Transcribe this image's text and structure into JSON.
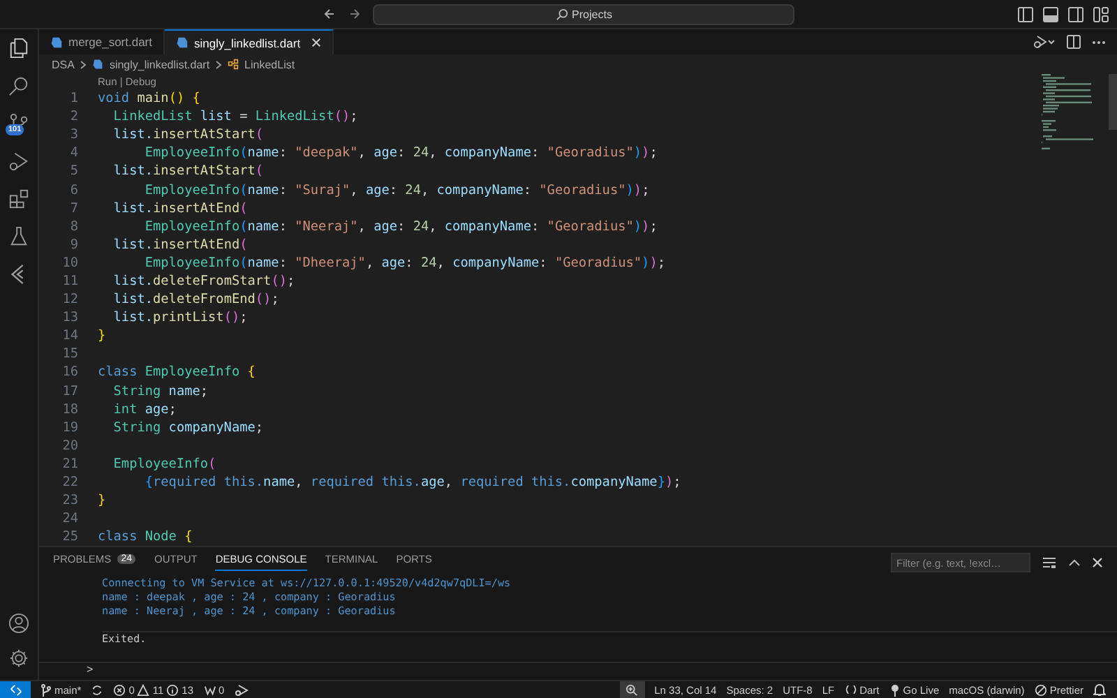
{
  "title_bar": {
    "search": "Projects"
  },
  "activity_bar": {
    "source_control_badge": "101"
  },
  "tabs": [
    {
      "label": "merge_sort.dart",
      "selected": false
    },
    {
      "label": "singly_linkedlist.dart",
      "selected": true
    }
  ],
  "breadcrumb": [
    "DSA",
    "singly_linkedlist.dart",
    "LinkedList"
  ],
  "codelens": "Run | Debug",
  "code_lines": [
    {
      "number": "1",
      "tokens": [
        {
          "text": "void ",
          "kind": "k"
        },
        {
          "text": "main",
          "kind": "f"
        },
        {
          "text": "() ",
          "kind": "b1"
        },
        {
          "text": "{",
          "kind": "b1"
        }
      ],
      "children": [
        {
          "number": "2",
          "tokens": [
            {
              "text": "LinkedList ",
              "kind": "t"
            },
            {
              "text": "list ",
              "kind": "v"
            },
            {
              "text": "= ",
              "kind": "p"
            },
            {
              "text": "LinkedList",
              "kind": "t"
            },
            {
              "text": "()",
              "kind": "b2"
            },
            {
              "text": ";",
              "kind": "p"
            }
          ]
        },
        {
          "number": "3",
          "tokens": [
            {
              "text": "list.",
              "kind": "v"
            },
            {
              "text": "insertAtStart",
              "kind": "f"
            },
            {
              "text": "(",
              "kind": "b2"
            }
          ],
          "children": [
            {
              "number": "4",
              "tokens": [
                {
                  "text": "EmployeeInfo",
                  "kind": "t"
                },
                {
                  "text": "(",
                  "kind": "b3"
                },
                {
                  "text": "name",
                  "kind": "v"
                },
                {
                  "text": ": ",
                  "kind": "p"
                },
                {
                  "text": "\"deepak\"",
                  "kind": "s"
                },
                {
                  "text": ", ",
                  "kind": "p"
                },
                {
                  "text": "age",
                  "kind": "v"
                },
                {
                  "text": ": ",
                  "kind": "p"
                },
                {
                  "text": "24",
                  "kind": "n"
                },
                {
                  "text": ", ",
                  "kind": "p"
                },
                {
                  "text": "companyName",
                  "kind": "v"
                },
                {
                  "text": ": ",
                  "kind": "p"
                },
                {
                  "text": "\"Georadius\"",
                  "kind": "s"
                },
                {
                  "text": ")",
                  "kind": "b3"
                },
                {
                  "text": ")",
                  "kind": "b2"
                },
                {
                  "text": ";",
                  "kind": "p"
                }
              ]
            }
          ]
        },
        {
          "number": "5",
          "tokens": [
            {
              "text": "list.",
              "kind": "v"
            },
            {
              "text": "insertAtStart",
              "kind": "f"
            },
            {
              "text": "(",
              "kind": "b2"
            }
          ],
          "children": [
            {
              "number": "6",
              "tokens": [
                {
                  "text": "EmployeeInfo",
                  "kind": "t"
                },
                {
                  "text": "(",
                  "kind": "b3"
                },
                {
                  "text": "name",
                  "kind": "v"
                },
                {
                  "text": ": ",
                  "kind": "p"
                },
                {
                  "text": "\"Suraj\"",
                  "kind": "s"
                },
                {
                  "text": ", ",
                  "kind": "p"
                },
                {
                  "text": "age",
                  "kind": "v"
                },
                {
                  "text": ": ",
                  "kind": "p"
                },
                {
                  "text": "24",
                  "kind": "n"
                },
                {
                  "text": ", ",
                  "kind": "p"
                },
                {
                  "text": "companyName",
                  "kind": "v"
                },
                {
                  "text": ": ",
                  "kind": "p"
                },
                {
                  "text": "\"Georadius\"",
                  "kind": "s"
                },
                {
                  "text": ")",
                  "kind": "b3"
                },
                {
                  "text": ")",
                  "kind": "b2"
                },
                {
                  "text": ";",
                  "kind": "p"
                }
              ]
            }
          ]
        },
        {
          "number": "7",
          "tokens": [
            {
              "text": "list.",
              "kind": "v"
            },
            {
              "text": "insertAtEnd",
              "kind": "f"
            },
            {
              "text": "(",
              "kind": "b2"
            }
          ],
          "children": [
            {
              "number": "8",
              "tokens": [
                {
                  "text": "EmployeeInfo",
                  "kind": "t"
                },
                {
                  "text": "(",
                  "kind": "b3"
                },
                {
                  "text": "name",
                  "kind": "v"
                },
                {
                  "text": ": ",
                  "kind": "p"
                },
                {
                  "text": "\"Neeraj\"",
                  "kind": "s"
                },
                {
                  "text": ", ",
                  "kind": "p"
                },
                {
                  "text": "age",
                  "kind": "v"
                },
                {
                  "text": ": ",
                  "kind": "p"
                },
                {
                  "text": "24",
                  "kind": "n"
                },
                {
                  "text": ", ",
                  "kind": "p"
                },
                {
                  "text": "companyName",
                  "kind": "v"
                },
                {
                  "text": ": ",
                  "kind": "p"
                },
                {
                  "text": "\"Georadius\"",
                  "kind": "s"
                },
                {
                  "text": ")",
                  "kind": "b3"
                },
                {
                  "text": ")",
                  "kind": "b2"
                },
                {
                  "text": ";",
                  "kind": "p"
                }
              ]
            }
          ]
        },
        {
          "number": "9",
          "tokens": [
            {
              "text": "list.",
              "kind": "v"
            },
            {
              "text": "insertAtEnd",
              "kind": "f"
            },
            {
              "text": "(",
              "kind": "b2"
            }
          ],
          "children": [
            {
              "number": "10",
              "tokens": [
                {
                  "text": "EmployeeInfo",
                  "kind": "t"
                },
                {
                  "text": "(",
                  "kind": "b3"
                },
                {
                  "text": "name",
                  "kind": "v"
                },
                {
                  "text": ": ",
                  "kind": "p"
                },
                {
                  "text": "\"Dheeraj\"",
                  "kind": "s"
                },
                {
                  "text": ", ",
                  "kind": "p"
                },
                {
                  "text": "age",
                  "kind": "v"
                },
                {
                  "text": ": ",
                  "kind": "p"
                },
                {
                  "text": "24",
                  "kind": "n"
                },
                {
                  "text": ", ",
                  "kind": "p"
                },
                {
                  "text": "companyName",
                  "kind": "v"
                },
                {
                  "text": ": ",
                  "kind": "p"
                },
                {
                  "text": "\"Georadius\"",
                  "kind": "s"
                },
                {
                  "text": ")",
                  "kind": "b3"
                },
                {
                  "text": ")",
                  "kind": "b2"
                },
                {
                  "text": ";",
                  "kind": "p"
                }
              ]
            }
          ]
        },
        {
          "number": "11",
          "tokens": [
            {
              "text": "list.",
              "kind": "v"
            },
            {
              "text": "deleteFromStart",
              "kind": "f"
            },
            {
              "text": "()",
              "kind": "b2"
            },
            {
              "text": ";",
              "kind": "p"
            }
          ]
        },
        {
          "number": "12",
          "tokens": [
            {
              "text": "list.",
              "kind": "v"
            },
            {
              "text": "deleteFromEnd",
              "kind": "f"
            },
            {
              "text": "()",
              "kind": "b2"
            },
            {
              "text": ";",
              "kind": "p"
            }
          ]
        },
        {
          "number": "13",
          "tokens": [
            {
              "text": "list.",
              "kind": "v"
            },
            {
              "text": "printList",
              "kind": "f"
            },
            {
              "text": "()",
              "kind": "b2"
            },
            {
              "text": ";",
              "kind": "p"
            }
          ]
        }
      ]
    },
    {
      "number": "14",
      "tokens": [
        {
          "text": "}",
          "kind": "b1"
        }
      ]
    },
    {
      "number": "15"
    },
    {
      "number": "16",
      "tokens": [
        {
          "text": "class ",
          "kind": "k"
        },
        {
          "text": "EmployeeInfo ",
          "kind": "t"
        },
        {
          "text": "{",
          "kind": "b1"
        }
      ],
      "children": [
        {
          "number": "17",
          "tokens": [
            {
              "text": "String ",
              "kind": "t"
            },
            {
              "text": "name",
              "kind": "v"
            },
            {
              "text": ";",
              "kind": "p"
            }
          ]
        },
        {
          "number": "18",
          "tokens": [
            {
              "text": "int ",
              "kind": "t"
            },
            {
              "text": "age",
              "kind": "v"
            },
            {
              "text": ";",
              "kind": "p"
            }
          ]
        },
        {
          "number": "19",
          "tokens": [
            {
              "text": "String ",
              "kind": "t"
            },
            {
              "text": "companyName",
              "kind": "v"
            },
            {
              "text": ";",
              "kind": "p"
            }
          ]
        },
        {
          "number": "20"
        },
        {
          "number": "21",
          "tokens": [
            {
              "text": "EmployeeInfo",
              "kind": "t"
            },
            {
              "text": "(",
              "kind": "b2"
            }
          ],
          "children": [
            {
              "number": "22",
              "tokens": [
                {
                  "text": "{",
                  "kind": "b3"
                },
                {
                  "text": "required this.",
                  "kind": "k"
                },
                {
                  "text": "name",
                  "kind": "v"
                },
                {
                  "text": ", ",
                  "kind": "p"
                },
                {
                  "text": "required this.",
                  "kind": "k"
                },
                {
                  "text": "age",
                  "kind": "v"
                },
                {
                  "text": ", ",
                  "kind": "p"
                },
                {
                  "text": "required this.",
                  "kind": "k"
                },
                {
                  "text": "companyName",
                  "kind": "v"
                },
                {
                  "text": "}",
                  "kind": "b3"
                },
                {
                  "text": ")",
                  "kind": "b2"
                },
                {
                  "text": ";",
                  "kind": "p"
                }
              ]
            }
          ]
        }
      ]
    },
    {
      "number": "23",
      "tokens": [
        {
          "text": "}",
          "kind": "b1"
        }
      ]
    },
    {
      "number": "24"
    },
    {
      "number": "25",
      "tokens": [
        {
          "text": "class ",
          "kind": "k"
        },
        {
          "text": "Node ",
          "kind": "t"
        },
        {
          "text": "{",
          "kind": "b1"
        }
      ]
    }
  ],
  "panel": {
    "tabs": [
      {
        "label": "PROBLEMS",
        "badge": "24",
        "selected": false
      },
      {
        "label": "OUTPUT",
        "selected": false
      },
      {
        "label": "DEBUG CONSOLE",
        "selected": true
      },
      {
        "label": "TERMINAL",
        "selected": false
      },
      {
        "label": "PORTS",
        "selected": false
      }
    ],
    "filter": {
      "placeholder": "Filter (e.g. text, !excl…"
    },
    "console_lines": [
      {
        "text": "Connecting to VM Service at ws://127.0.0.1:49520/v4d2qw7qDLI=/ws",
        "kind": "output"
      },
      {
        "text": "name : deepak , age : 24 , company : Georadius",
        "kind": "output"
      },
      {
        "text": "name : Neeraj , age : 24 , company : Georadius",
        "kind": "output"
      },
      {
        "text": "Exited.",
        "kind": "status"
      }
    ],
    "prompt": ">"
  },
  "status_bar": {
    "branch": "main*",
    "errors": "0",
    "warnings": "11",
    "infos": "13",
    "ports": "0",
    "cursor": "Ln 33, Col 14",
    "spaces": "Spaces: 2",
    "encoding": "UTF-8",
    "eol": "LF",
    "language": "Dart",
    "go_live": "Go Live",
    "platform": "macOS (darwin)",
    "formatter": "Prettier"
  }
}
